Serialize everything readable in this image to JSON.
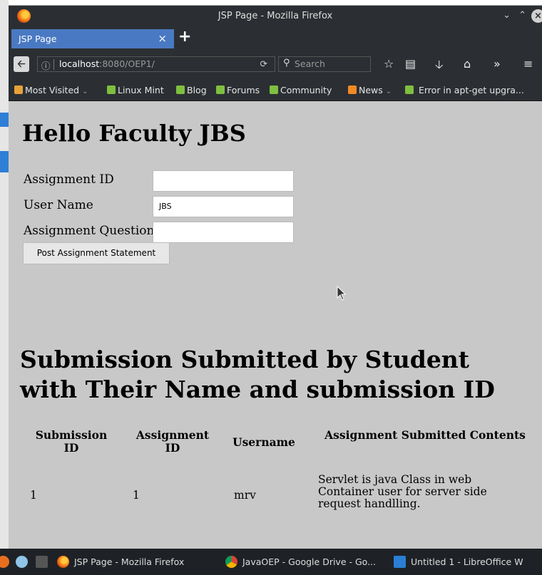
{
  "window": {
    "title": "JSP Page - Mozilla Firefox"
  },
  "tab": {
    "label": "JSP Page"
  },
  "url": {
    "host": "localhost",
    "path": ":8080/OEP1/"
  },
  "search": {
    "placeholder": "Search"
  },
  "bookmarks": [
    {
      "label": "Most Visited",
      "icon": "folder-icon"
    },
    {
      "label": "Linux Mint",
      "icon": "mint-icon"
    },
    {
      "label": "Blog",
      "icon": "mint-icon"
    },
    {
      "label": "Forums",
      "icon": "mint-icon"
    },
    {
      "label": "Community",
      "icon": "mint-icon"
    },
    {
      "label": "News",
      "icon": "rss-icon"
    },
    {
      "label": "Error in apt-get upgra...",
      "icon": "mint-icon"
    }
  ],
  "page": {
    "heading": "Hello Faculty JBS",
    "form": {
      "assignment_id_label": "Assignment ID",
      "assignment_id_value": "",
      "user_name_label": "User Name",
      "user_name_value": "JBS",
      "question_label": "Assignment Question",
      "question_value": "",
      "submit_label": "Post Assignment Statement"
    },
    "submissions_heading": "Submission Submitted by Student with Their Name and submission ID",
    "table": {
      "headers": [
        "Submission ID",
        "Assignment ID",
        "Username",
        "Assignment Submitted Contents"
      ],
      "rows": [
        [
          "1",
          "1",
          "mrv",
          "Servlet is java Class in web Container user for server side request handlling."
        ]
      ]
    }
  },
  "taskbar": {
    "items": [
      {
        "label": "JSP Page - Mozilla Firefox"
      },
      {
        "label": "JavaOEP - Google Drive - Go..."
      },
      {
        "label": "Untitled 1 - LibreOffice W"
      }
    ]
  },
  "colors": {
    "tab_active": "#4a79c3",
    "chrome_dark": "#2b2f33",
    "page_bg": "#c8c8c8"
  }
}
